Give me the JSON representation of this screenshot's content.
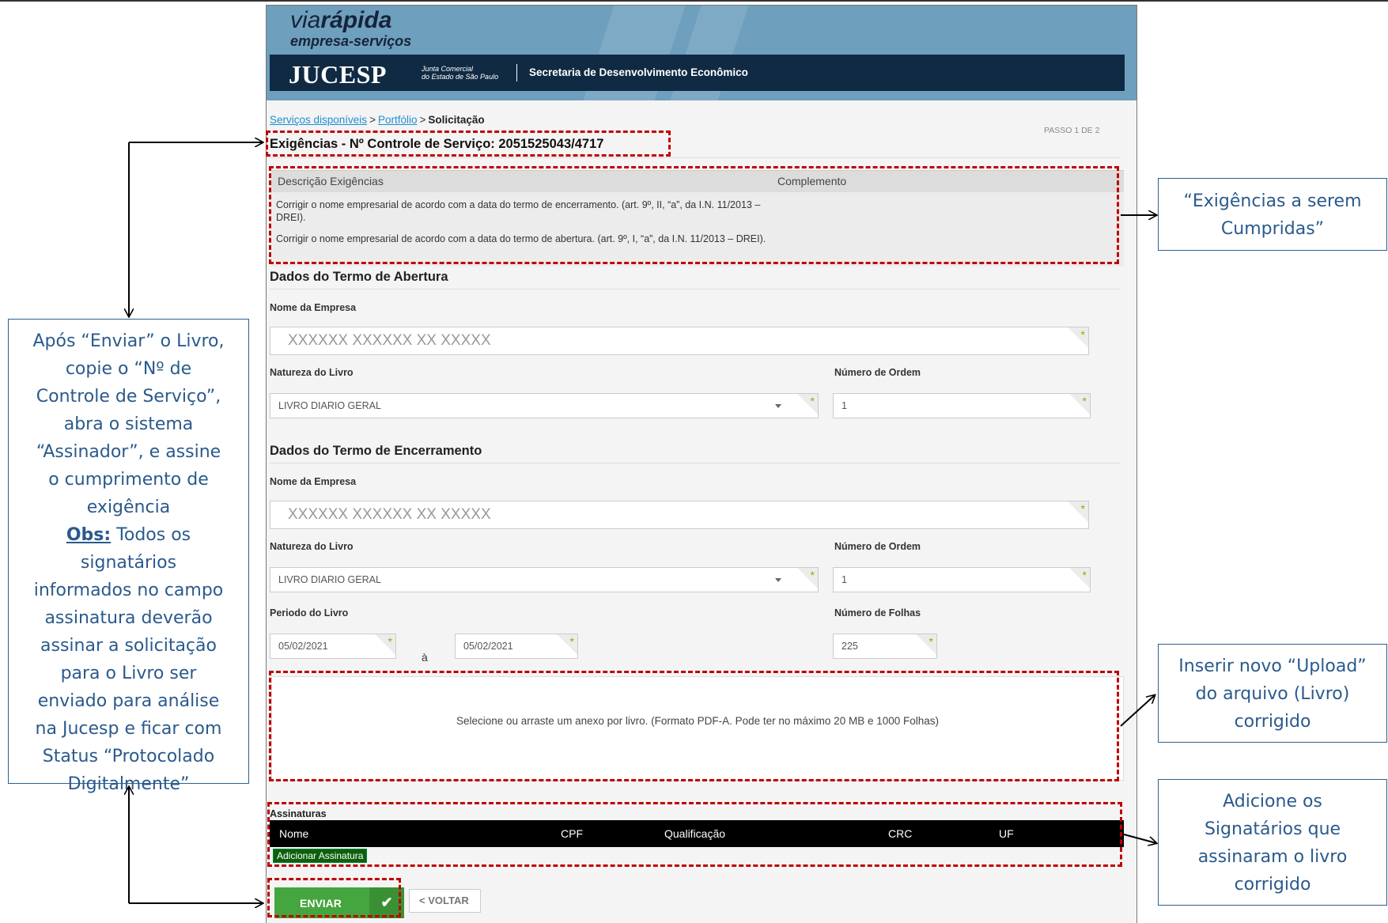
{
  "header": {
    "logo_via": "via",
    "logo_rapida": "rápida",
    "logo_sub": "empresa-serviços",
    "org": "JUCESP",
    "org_sub_1": "Junta Comercial",
    "org_sub_2": "do Estado de São Paulo",
    "secretaria": "Secretaria de Desenvolvimento Econômico"
  },
  "breadcrumb": {
    "item1": "Serviços disponíveis",
    "item2": "Portfólio",
    "current": "Solicitação",
    "separator": ">"
  },
  "step": "PASSO 1 DE 2",
  "exigencias": {
    "title": "Exigências - Nº Controle de Serviço: 2051525043/4717",
    "col1": "Descrição Exigências",
    "col2": "Complemento",
    "rows": [
      "Corrigir o nome empresarial de acordo com a data do termo de encerramento. (art. 9º, II, “a”, da I.N. 11/2013 – DREI).",
      "Corrigir o nome empresarial de acordo com a data do termo de abertura. (art. 9º, I, “a”, da I.N. 11/2013 – DREI)."
    ]
  },
  "abertura": {
    "title": "Dados do Termo de Abertura",
    "nome_label": "Nome da Empresa",
    "nome_value": "XXXXXX XXXXXX XX XXXXX",
    "natureza_label": "Natureza do Livro",
    "natureza_value": "LIVRO DIARIO GERAL",
    "ordem_label": "Número de Ordem",
    "ordem_value": "1"
  },
  "encerramento": {
    "title": "Dados do Termo de Encerramento",
    "nome_label": "Nome da Empresa",
    "nome_value": "XXXXXX XXXXXX XX XXXXX",
    "natureza_label": "Natureza do Livro",
    "natureza_value": "LIVRO DIARIO GERAL",
    "ordem_label": "Número de Ordem",
    "ordem_value": "1",
    "periodo_label": "Periodo do Livro",
    "periodo_inicio": "05/02/2021",
    "periodo_sep": "à",
    "periodo_fim": "05/02/2021",
    "folhas_label": "Número de Folhas",
    "folhas_value": "225"
  },
  "upload": {
    "text": "Selecione ou arraste um anexo por livro. (Formato PDF-A. Pode ter no máximo 20 MB e 1000 Folhas)"
  },
  "assinaturas": {
    "label": "Assinaturas",
    "columns": [
      "Nome",
      "CPF",
      "Qualificação",
      "CRC",
      "UF"
    ],
    "add_label": "Adicionar Assinatura"
  },
  "buttons": {
    "enviar": "ENVIAR",
    "enviar_icon": "✔",
    "voltar": "< VOLTAR"
  },
  "required_mark": "*",
  "annotations": {
    "left_lines": [
      "Após “Enviar” o Livro,",
      "copie o “Nº de",
      "Controle de Serviço”,",
      "abra o sistema",
      "“Assinador”, e assine",
      "o cumprimento de",
      "exigência"
    ],
    "left_obs": "Obs:",
    "left_obs_lines": [
      " Todos os",
      "signatários",
      "informados no campo",
      "assinatura deverão",
      "assinar a solicitação",
      "para o Livro ser",
      "enviado para análise",
      "na Jucesp e ficar com",
      "Status “Protocolado",
      "Digitalmente”"
    ],
    "right1_lines": [
      "“Exigências  a serem",
      "Cumpridas”"
    ],
    "right2_lines": [
      "Inserir novo “Upload”",
      "do arquivo (Livro)",
      "corrigido"
    ],
    "right3_lines": [
      "Adicione os",
      "Signatários que",
      "assinaram o livro",
      "corrigido"
    ]
  },
  "colors": {
    "banner": "#6e9fbd",
    "header_bar": "#102a43",
    "annotation_red": "#c00000",
    "callout_text": "#2a5a8c",
    "enviar_green": "#45a53f"
  }
}
